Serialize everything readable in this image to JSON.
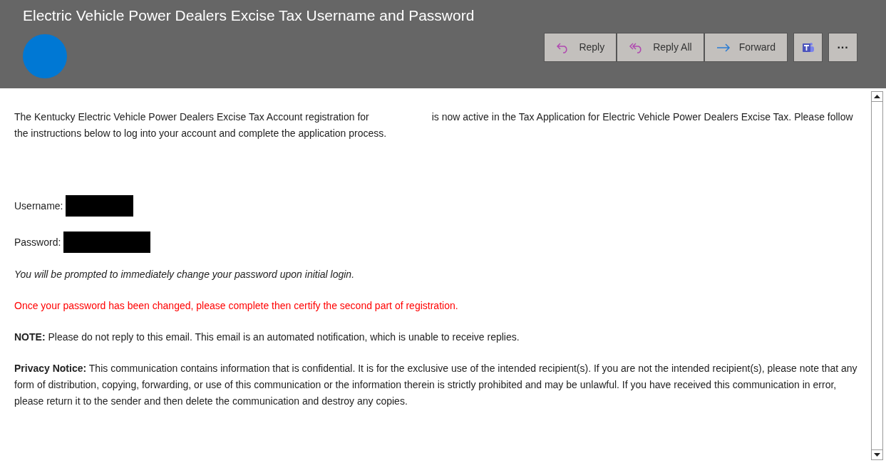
{
  "header": {
    "title": "Electric Vehicle Power Dealers Excise Tax Username and Password"
  },
  "toolbar": [
    {
      "kind": "reply",
      "label": "Reply"
    },
    {
      "kind": "reply_all",
      "label": "Reply All"
    },
    {
      "kind": "forward",
      "label": "Forward"
    },
    {
      "kind": "teams"
    },
    {
      "kind": "more",
      "label": "···"
    }
  ],
  "body": {
    "intro": [
      "The Kentucky Electric Vehicle Power Dealers Excise Tax Account registration for",
      "is now active in the Tax Application for Electric Vehicle Power Dealers Excise Tax. Please follow the instructions below to log into your account and complete the application process."
    ],
    "credentials": [
      {
        "label": "Username:",
        "redacted": true
      },
      {
        "label": "Password:",
        "redacted": true
      }
    ],
    "paragraphs": [
      {
        "kind": "italic",
        "text": "You will be prompted to immediately change your password upon initial login."
      },
      {
        "kind": "warning",
        "text": "Once your password has been changed, please complete then certify the second part of registration."
      },
      {
        "kind": "plain",
        "text": "**NOTE:** Please do not reply to this email. This email is an automated notification, which is unable to receive replies."
      },
      {
        "kind": "plain",
        "text": "**Privacy Notice:** This communication contains information that is confidential. It is for the exclusive use of the intended recipient(s). If you are not the intended recipient(s), please note that any form of distribution, copying, forwarding, or use of this communication or the information therein is strictly prohibited and may be unlawful. If you have received this communication in error, please return it to the sender and then delete the communication and destroy any copies."
      }
    ]
  }
}
